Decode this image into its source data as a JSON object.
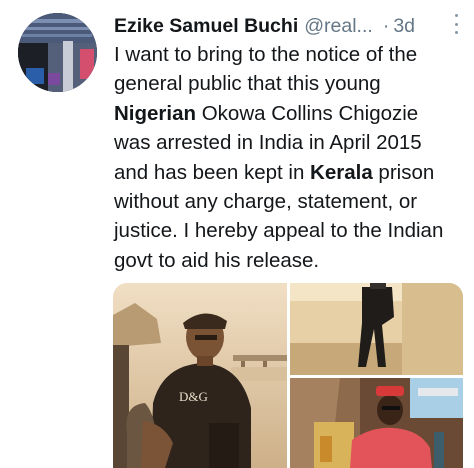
{
  "tweet": {
    "author_name": "Ezike Samuel Buchi",
    "handle": "@real...",
    "separator": "·",
    "time": "3d",
    "body_lines": [
      [
        {
          "t": "I want to bring to the notice of the"
        }
      ],
      [
        {
          "t": "general public that this young"
        }
      ],
      [
        {
          "t": "Nigerian",
          "b": true
        },
        {
          "t": " Okowa Collins Chigozie"
        }
      ],
      [
        {
          "t": "was arrested in India in April 2015"
        }
      ],
      [
        {
          "t": "and has been kept in "
        },
        {
          "t": "Kerala",
          "b": true
        },
        {
          "t": " prison"
        }
      ],
      [
        {
          "t": "without any charge, statement, or"
        }
      ],
      [
        {
          "t": "justice. I hereby appeal to the Indian"
        }
      ],
      [
        {
          "t": "govt to aid his release."
        }
      ]
    ]
  },
  "photos": [
    {
      "desc": "man-in-cap-sepia-photo",
      "shirt_text": "D&G"
    },
    {
      "desc": "person-standing-by-wall-photo"
    },
    {
      "desc": "man-in-red-shirt-at-bar-photo"
    }
  ]
}
